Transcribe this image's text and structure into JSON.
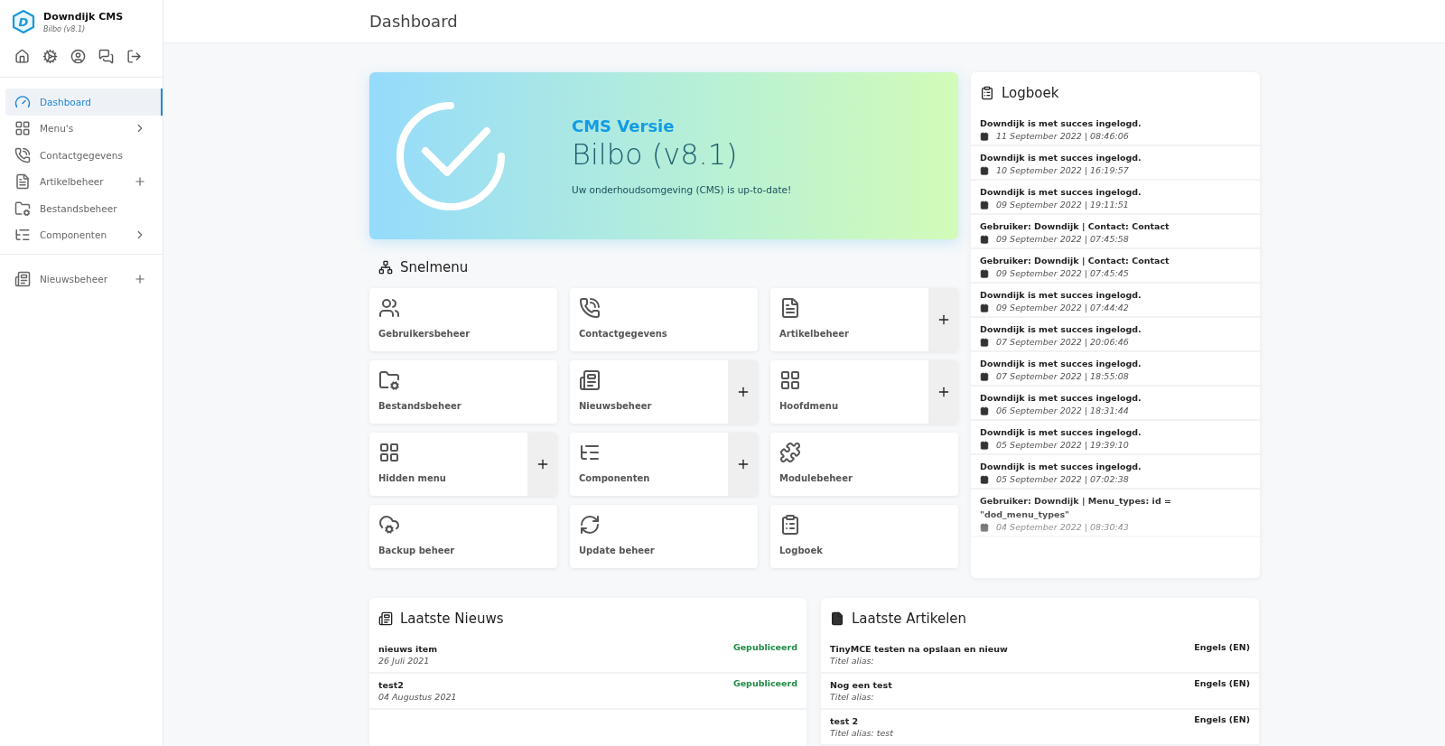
{
  "sidebar": {
    "logo": "D",
    "title": "Downdijk CMS",
    "subtitle": "Bilbo (v8.1)",
    "sections": [
      {
        "items": [
          {
            "label": "Dashboard",
            "selected": true,
            "expandable": false,
            "addable": false
          },
          {
            "label": "Menu's",
            "selected": false,
            "expandable": true,
            "addable": false
          },
          {
            "label": "Contactgegevens",
            "selected": false,
            "expandable": false,
            "addable": false
          },
          {
            "label": "Artikelbeheer",
            "selected": false,
            "expandable": false,
            "addable": true
          },
          {
            "label": "Bestandsbeheer",
            "selected": false,
            "expandable": false,
            "addable": false
          },
          {
            "label": "Componenten",
            "selected": false,
            "expandable": true,
            "addable": false
          }
        ]
      },
      {
        "items": [
          {
            "label": "Nieuwsbeheer",
            "selected": false,
            "expandable": false,
            "addable": true
          }
        ]
      }
    ]
  },
  "header": {
    "title": "Dashboard"
  },
  "banner": {
    "heading": "CMS Versie",
    "version": "Bilbo (v8.1)",
    "message": "Uw onderhoudsomgeving (CMS) is up-to-date!"
  },
  "snelmenu": {
    "title": "Snelmenu",
    "tiles": [
      {
        "label": "Gebruikersbeheer",
        "add": false
      },
      {
        "label": "Contactgegevens",
        "add": false
      },
      {
        "label": "Artikelbeheer",
        "add": true
      },
      {
        "label": "Bestandsbeheer",
        "add": false
      },
      {
        "label": "Nieuwsbeheer",
        "add": true
      },
      {
        "label": "Hoofdmenu",
        "add": true
      },
      {
        "label": "Hidden menu",
        "add": true
      },
      {
        "label": "Componenten",
        "add": true
      },
      {
        "label": "Modulebeheer",
        "add": false
      },
      {
        "label": "Backup beheer",
        "add": false
      },
      {
        "label": "Update beheer",
        "add": false
      },
      {
        "label": "Logboek",
        "add": false
      }
    ]
  },
  "logbook": {
    "title": "Logboek",
    "entries": [
      {
        "message": "Downdijk is met succes ingelogd.",
        "date": "11 September 2022 | 08:46:06"
      },
      {
        "message": "Downdijk is met succes ingelogd.",
        "date": "10 September 2022 | 16:19:57"
      },
      {
        "message": "Downdijk is met succes ingelogd.",
        "date": "09 September 2022 | 19:11:51"
      },
      {
        "message": "Gebruiker: Downdijk | Contact: Contact",
        "date": "09 September 2022 | 07:45:58"
      },
      {
        "message": "Gebruiker: Downdijk | Contact: Contact",
        "date": "09 September 2022 | 07:45:45"
      },
      {
        "message": "Downdijk is met succes ingelogd.",
        "date": "09 September 2022 | 07:44:42"
      },
      {
        "message": "Downdijk is met succes ingelogd.",
        "date": "07 September 2022 | 20:06:46"
      },
      {
        "message": "Downdijk is met succes ingelogd.",
        "date": "07 September 2022 | 18:55:08"
      },
      {
        "message": "Downdijk is met succes ingelogd.",
        "date": "06 September 2022 | 18:31:44"
      },
      {
        "message": "Downdijk is met succes ingelogd.",
        "date": "05 September 2022 | 19:39:10"
      },
      {
        "message": "Downdijk is met succes ingelogd.",
        "date": "05 September 2022 | 07:02:38"
      },
      {
        "message": "Gebruiker: Downdijk | Menu_types: id = \"dod_menu_types\"",
        "date": "04 September 2022 | 08:30:43"
      }
    ]
  },
  "news": {
    "title": "Laatste Nieuws",
    "items": [
      {
        "title": "nieuws item",
        "date": "26 Juli 2021",
        "status": "Gepubliceerd"
      },
      {
        "title": "test2",
        "date": "04 Augustus 2021",
        "status": "Gepubliceerd"
      }
    ]
  },
  "articles": {
    "title": "Laatste Artikelen",
    "items": [
      {
        "title": "TinyMCE testen na opslaan en nieuw",
        "alias": "Titel alias:",
        "language": "Engels (EN)"
      },
      {
        "title": "Nog een test",
        "alias": "Titel alias:",
        "language": "Engels (EN)"
      },
      {
        "title": "test 2",
        "alias": "Titel alias: test",
        "language": "Engels (EN)"
      }
    ]
  }
}
